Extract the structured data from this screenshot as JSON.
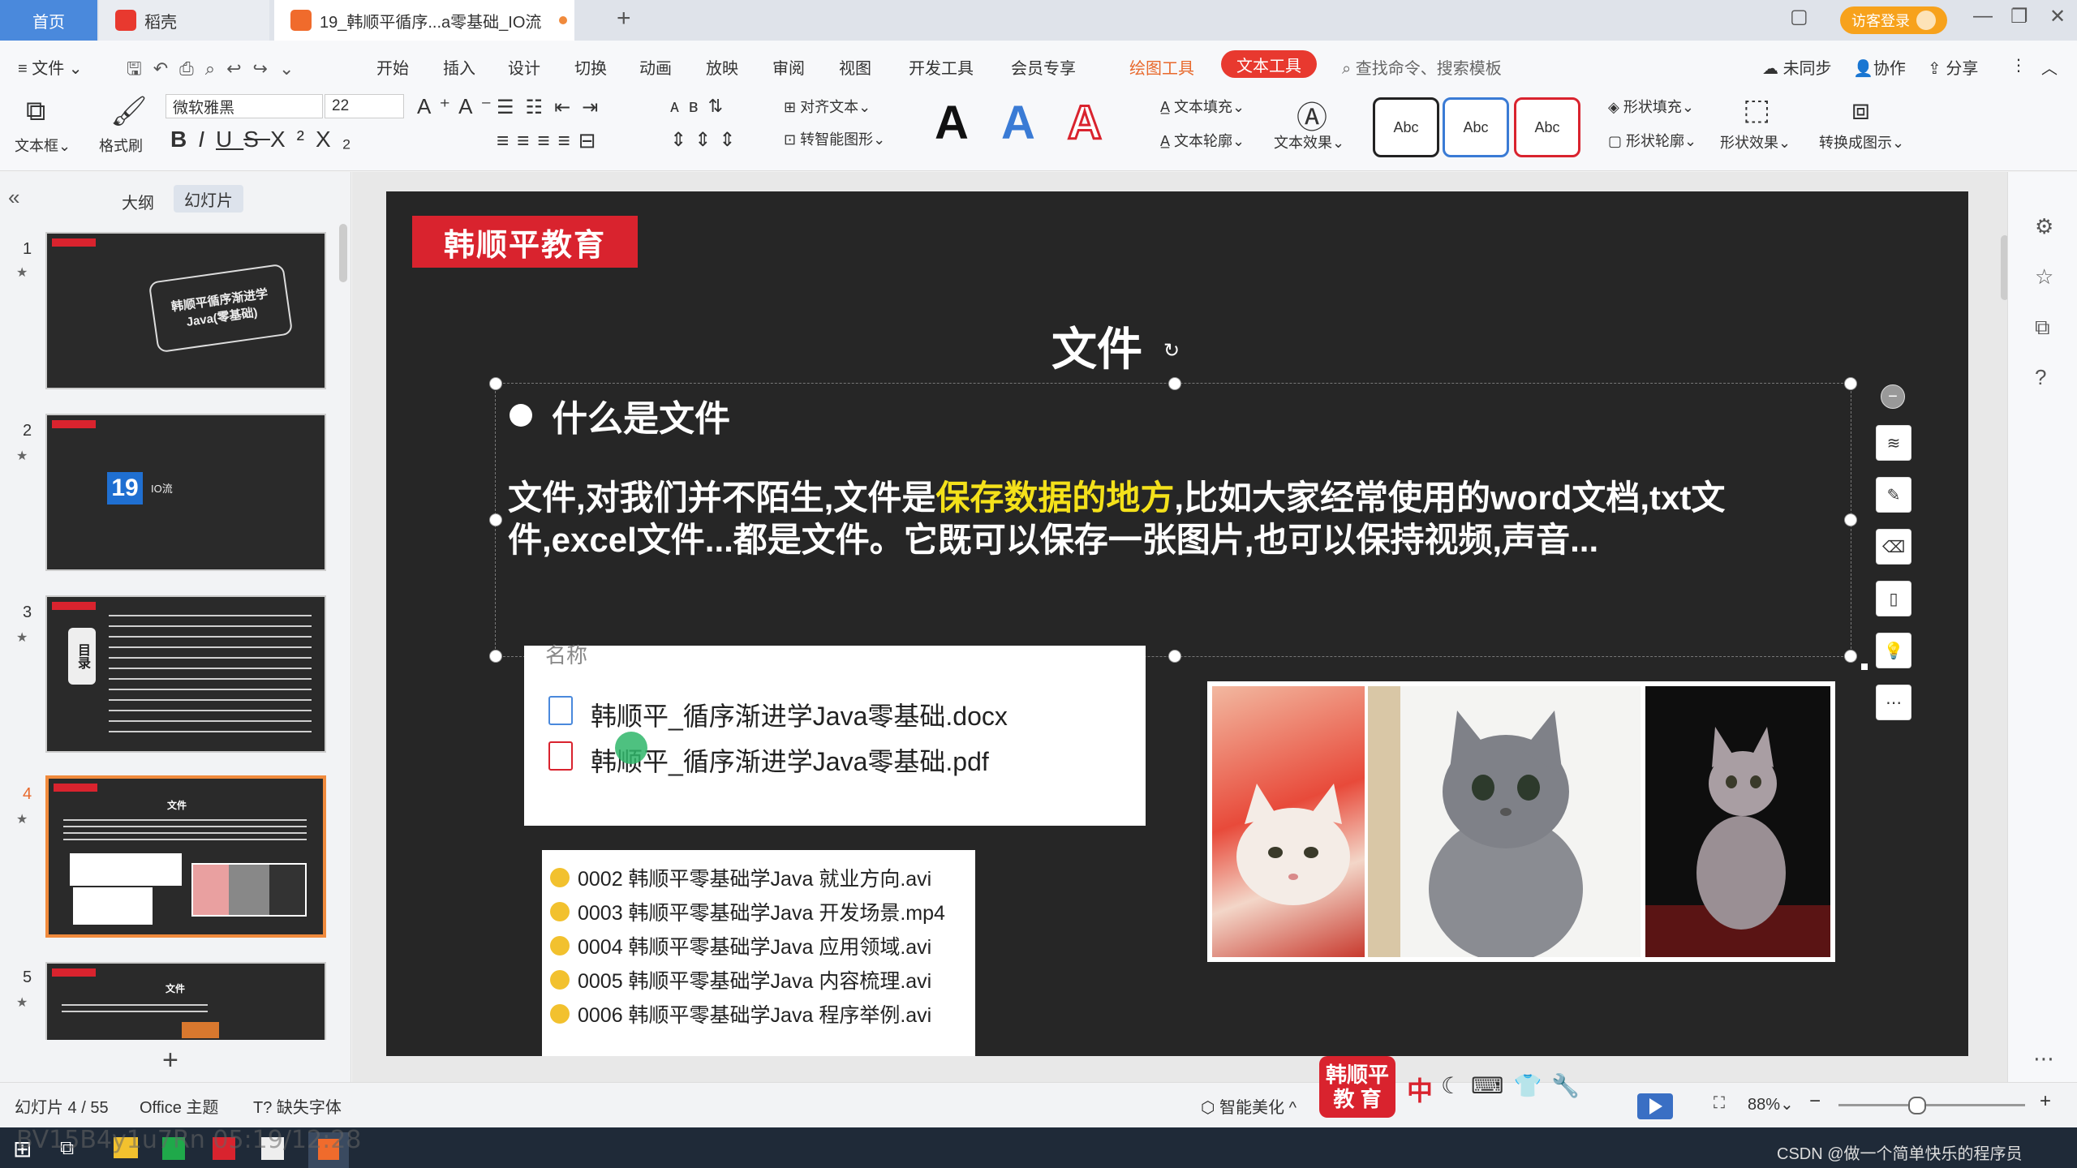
{
  "tabs": {
    "home": "首页",
    "daoke": "稻壳",
    "doc": "19_韩顺平循序...a零基础_IO流",
    "login": "访客登录"
  },
  "menu": {
    "file": "文件",
    "items": [
      "开始",
      "插入",
      "设计",
      "切换",
      "动画",
      "放映",
      "审阅",
      "视图",
      "开发工具",
      "会员专享",
      "绘图工具"
    ],
    "text_tool": "文本工具",
    "search": "查找命令、搜索模板",
    "sync": "未同步",
    "collab": "协作",
    "share": "分享"
  },
  "toolbar": {
    "textbox": "文本框",
    "format_painter": "格式刷",
    "font": "微软雅黑",
    "size": "22",
    "align_text": "对齐文本",
    "smart_graphic": "转智能图形",
    "text_fill": "文本填充",
    "text_outline": "文本轮廓",
    "text_effect": "文本效果",
    "abc": "Abc",
    "shape_fill": "形状填充",
    "shape_outline": "形状轮廓",
    "shape_effect": "形状效果",
    "convert": "转换成图示",
    "styles": [
      "A",
      "A",
      "A"
    ]
  },
  "left": {
    "outline": "大纲",
    "slides": "幻灯片",
    "thumbs": [
      {
        "num": "1",
        "text": "韩顺平循序渐进学Java(零基础)"
      },
      {
        "num": "2",
        "text": "IO流",
        "badge": "19"
      },
      {
        "num": "3",
        "text": "目录"
      },
      {
        "num": "4",
        "text": "文件"
      },
      {
        "num": "5",
        "text": "文件"
      }
    ]
  },
  "slide": {
    "logo": "韩顺平教育",
    "title": "文件",
    "heading": "什么是文件",
    "para_a": "文件,对我们并不陌生,文件是",
    "para_hl": "保存数据的地方",
    "para_b": ",比如大家经常使用的word文档,txt文件,excel文件...都是文件。它既可以保存一张图片,也可以保持视频,声音...",
    "box_label": "名称",
    "files": [
      "韩顺平_循序渐进学Java零基础.docx",
      "韩顺平_循序渐进学Java零基础.pdf"
    ],
    "videos": [
      "0002  韩顺平零基础学Java  就业方向.avi",
      "0003 韩顺平零基础学Java 开发场景.mp4",
      "0004  韩顺平零基础学Java  应用领域.avi",
      "0005  韩顺平零基础学Java  内容梳理.avi",
      "0006  韩顺平零基础学Java  程序举例.avi"
    ]
  },
  "status": {
    "slide_info": "幻灯片 4 / 55",
    "theme": "Office 主题",
    "missing_font": "缺失字体",
    "smart_beautify": "智能美化",
    "zoom": "88%",
    "badge": "韩顺平\n教 育",
    "ime": "中"
  },
  "taskbar": {
    "watermark": "BV15B4y1u7Rn 05:19/12:28",
    "tray": "CSDN @做一个简单快乐的程序员"
  },
  "colors": {
    "accent": "#e8392f",
    "brand_red": "#d9232e",
    "highlight": "#f4e11a",
    "tab_blue": "#4a89dc"
  }
}
